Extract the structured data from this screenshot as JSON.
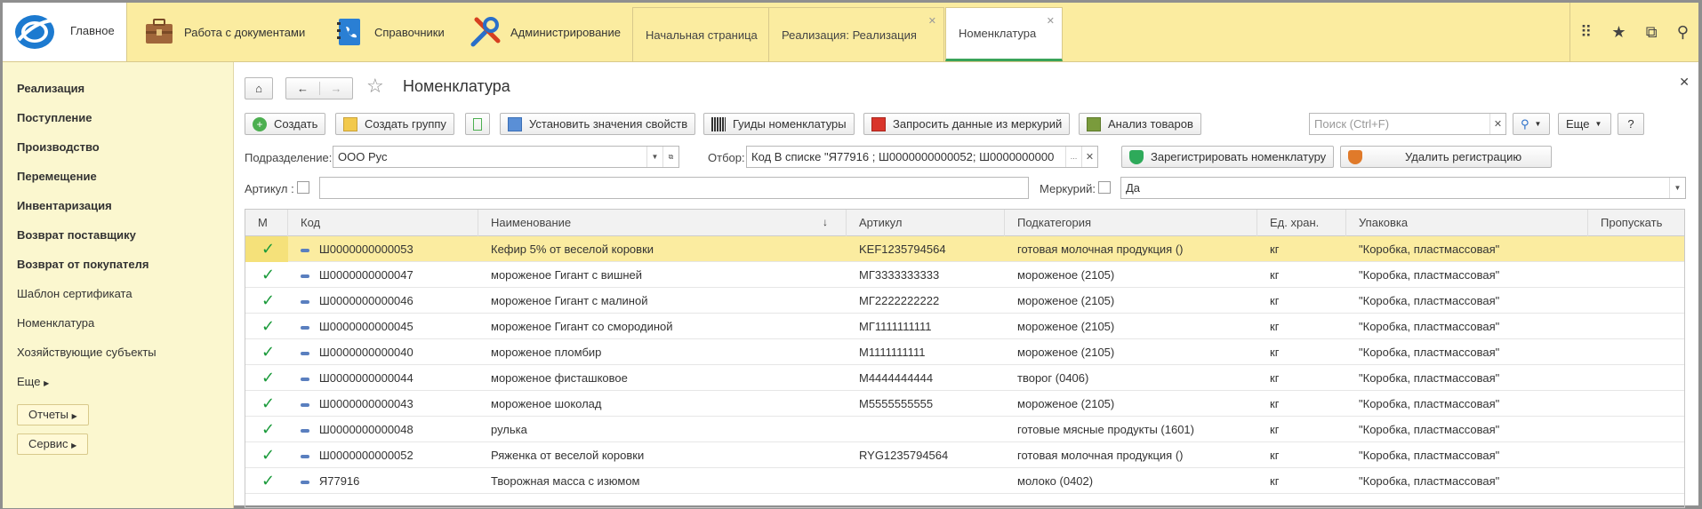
{
  "topbar": {
    "main_label": "Главное",
    "sections": [
      {
        "label": "Работа с документами",
        "icon": "briefcase-icon"
      },
      {
        "label": "Справочники",
        "icon": "phonebook-icon"
      },
      {
        "label": "Администрирование",
        "icon": "tools-icon"
      }
    ],
    "tabs": [
      {
        "label": "Начальная страница",
        "closable": false
      },
      {
        "label": "Реализация: Реализация",
        "closable": true
      },
      {
        "label": "Номенклатура",
        "closable": true,
        "active": true
      }
    ]
  },
  "sidebar": {
    "items": [
      {
        "label": "Реализация",
        "bold": true
      },
      {
        "label": "Поступление",
        "bold": true
      },
      {
        "label": "Производство",
        "bold": true
      },
      {
        "label": "Перемещение",
        "bold": true
      },
      {
        "label": "Инвентаризация",
        "bold": true
      },
      {
        "label": "Возврат поставщику",
        "bold": true
      },
      {
        "label": "Возврат от покупателя",
        "bold": true
      },
      {
        "label": "Шаблон сертификата",
        "bold": false
      },
      {
        "label": "Номенклатура",
        "bold": false
      },
      {
        "label": "Хозяйствующие субъекты",
        "bold": false
      }
    ],
    "more": "Еще",
    "reports_btn": "Отчеты",
    "service_btn": "Сервис"
  },
  "form": {
    "title": "Номенклатура",
    "toolbar": {
      "create": "Создать",
      "create_group": "Создать группу",
      "set_props": "Установить значения свойств",
      "guids": "Гуиды номенклатуры",
      "request_mercury": "Запросить данные из меркурий",
      "analysis": "Анализ товаров",
      "more": "Еще",
      "help": "?"
    },
    "search": {
      "placeholder": "Поиск (Ctrl+F)"
    },
    "filters": {
      "division_label": "Подразделение:",
      "division_value": "ООО Рус",
      "selection_label": "Отбор:",
      "selection_value": "Код В списке \"Я77916        ; Ш0000000000052; Ш0000000000",
      "register_btn": "Зарегистрировать номенклатуру",
      "unregister_btn": "Удалить регистрацию",
      "article_label": "Артикул :",
      "mercury_label": "Меркурий:",
      "mercury_value": "Да"
    }
  },
  "table": {
    "columns": [
      "М",
      "Код",
      "Наименование",
      "Артикул",
      "Подкатегория",
      "Ед. хран.",
      "Упаковка",
      "Пропускать"
    ],
    "sort_indicator": "↓",
    "rows": [
      {
        "code": "Ш0000000000053",
        "name": "Кефир 5% от веселой коровки",
        "article": "KEF1235794564",
        "subcategory": "готовая молочная продукция ()",
        "unit": "кг",
        "package": "\"Коробка, пластмассовая\"",
        "selected": true
      },
      {
        "code": "Ш0000000000047",
        "name": "мороженое Гигант с вишней",
        "article": "МГ3333333333",
        "subcategory": "мороженое (2105)",
        "unit": "кг",
        "package": "\"Коробка, пластмассовая\""
      },
      {
        "code": "Ш0000000000046",
        "name": "мороженое Гигант с малиной",
        "article": "МГ2222222222",
        "subcategory": "мороженое (2105)",
        "unit": "кг",
        "package": "\"Коробка, пластмассовая\""
      },
      {
        "code": "Ш0000000000045",
        "name": "мороженое Гигант со смородиной",
        "article": "МГ1111111111",
        "subcategory": "мороженое (2105)",
        "unit": "кг",
        "package": "\"Коробка, пластмассовая\""
      },
      {
        "code": "Ш0000000000040",
        "name": "мороженое пломбир",
        "article": "М1111111111",
        "subcategory": "мороженое (2105)",
        "unit": "кг",
        "package": "\"Коробка, пластмассовая\""
      },
      {
        "code": "Ш0000000000044",
        "name": "мороженое фисташковое",
        "article": "М4444444444",
        "subcategory": "творог (0406)",
        "unit": "кг",
        "package": "\"Коробка, пластмассовая\""
      },
      {
        "code": "Ш0000000000043",
        "name": "мороженое шоколад",
        "article": "М5555555555",
        "subcategory": "мороженое (2105)",
        "unit": "кг",
        "package": "\"Коробка, пластмассовая\""
      },
      {
        "code": "Ш0000000000048",
        "name": "рулька",
        "article": "",
        "subcategory": "готовые мясные продукты (1601)",
        "unit": "кг",
        "package": "\"Коробка, пластмассовая\""
      },
      {
        "code": "Ш0000000000052",
        "name": "Ряженка от веселой коровки",
        "article": "RYG1235794564",
        "subcategory": "готовая молочная продукция ()",
        "unit": "кг",
        "package": "\"Коробка, пластмассовая\""
      },
      {
        "code": "Я77916",
        "name": "Творожная масса с изюмом",
        "article": "",
        "subcategory": "молоко (0402)",
        "unit": "кг",
        "package": "\"Коробка, пластмассовая\""
      }
    ]
  }
}
